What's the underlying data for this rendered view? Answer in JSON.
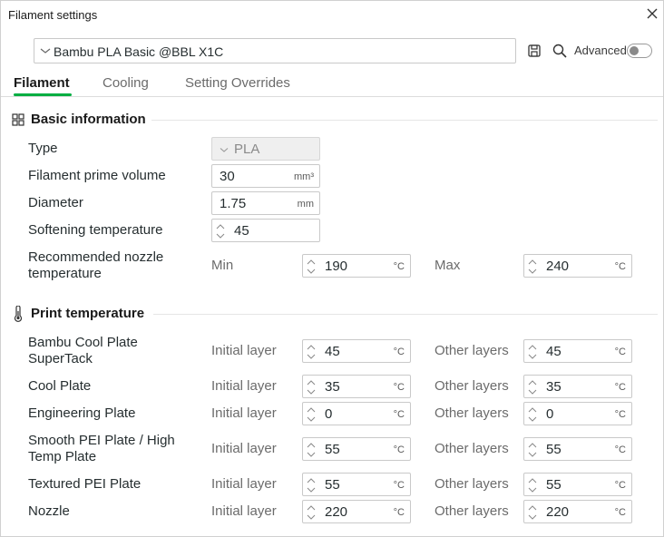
{
  "window": {
    "title": "Filament settings"
  },
  "preset": {
    "name": "Bambu PLA Basic @BBL X1C"
  },
  "advanced": {
    "label": "Advanced",
    "enabled": false
  },
  "tabs": [
    {
      "label": "Filament",
      "active": true
    },
    {
      "label": "Cooling",
      "active": false
    },
    {
      "label": "Setting Overrides",
      "active": false
    }
  ],
  "basic": {
    "title": "Basic information",
    "type": {
      "label": "Type",
      "value": "PLA"
    },
    "prime_volume": {
      "label": "Filament prime volume",
      "value": "30",
      "unit": "mm³"
    },
    "diameter": {
      "label": "Diameter",
      "value": "1.75",
      "unit": "mm"
    },
    "softening": {
      "label": "Softening temperature",
      "value": "45"
    },
    "nozzle_range": {
      "label": "Recommended nozzle temperature",
      "min_label": "Min",
      "min_value": "190",
      "max_label": "Max",
      "max_value": "240",
      "unit": "°C"
    }
  },
  "print": {
    "title": "Print temperature",
    "initial_label": "Initial layer",
    "other_label": "Other layers",
    "unit": "°C",
    "rows": [
      {
        "label": "Bambu Cool Plate SuperTack",
        "initial": "45",
        "other": "45"
      },
      {
        "label": "Cool Plate",
        "initial": "35",
        "other": "35"
      },
      {
        "label": "Engineering Plate",
        "initial": "0",
        "other": "0"
      },
      {
        "label": "Smooth PEI Plate / High Temp Plate",
        "initial": "55",
        "other": "55"
      },
      {
        "label": "Textured PEI Plate",
        "initial": "55",
        "other": "55"
      },
      {
        "label": "Nozzle",
        "initial": "220",
        "other": "220"
      }
    ]
  },
  "colors": {
    "accent": "#00ae42",
    "text": "#262e30",
    "muted": "#6b6b6b"
  },
  "icons": {
    "close": "close-icon",
    "chevron": "chevron-down-icon",
    "save": "save-icon",
    "search": "search-icon",
    "basic": "grid-icon",
    "print": "thermometer-icon",
    "spin": "spinner-arrows-icon"
  }
}
